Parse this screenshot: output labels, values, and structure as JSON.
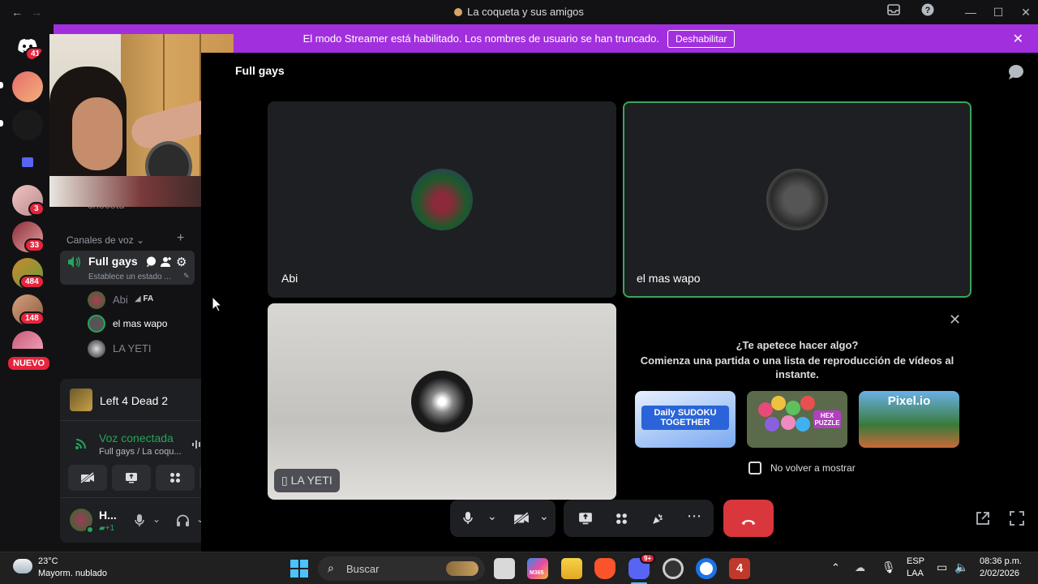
{
  "window": {
    "title": "La coqueta y sus amigos"
  },
  "banner": {
    "text": "El modo Streamer está habilitado. Los nombres de usuario se han truncado.",
    "button": "Deshabilitar"
  },
  "servers": {
    "home_badge": "41",
    "badges": [
      "3",
      "33",
      "484",
      "148"
    ],
    "new_label": "NUEVO"
  },
  "sidebar": {
    "hidden_channel": "chocotu",
    "section": "Canales de voz",
    "voice_channel": {
      "name": "Full gays",
      "status": "Establece un estado ..."
    },
    "members": [
      {
        "name": "Abi",
        "tag": "FA"
      },
      {
        "name": "el mas wapo"
      },
      {
        "name": "LA YETI"
      }
    ],
    "activity": {
      "game": "Left 4 Dead 2"
    },
    "voice": {
      "status": "Voz conectada",
      "detail": "Full gays / La coqu..."
    },
    "user": {
      "name": "H...",
      "sub": "+1"
    }
  },
  "main": {
    "channel": "Full gays",
    "tiles": [
      {
        "name": "Abi"
      },
      {
        "name": "el mas wapo"
      },
      {
        "name": "LA YETI"
      }
    ],
    "activity_card": {
      "title": "¿Te apetece hacer algo?",
      "subtitle": "Comienza una partida o una lista de reproducción de vídeos al instante.",
      "games": [
        "Daily SUDOKU TOGETHER",
        "HEX PUZZLE",
        "Pixel.io"
      ],
      "checkbox": "No volver a mostrar"
    }
  },
  "taskbar": {
    "weather_temp": "23°C",
    "weather_desc": "Mayorm. nublado",
    "search": "Buscar",
    "lang1": "ESP",
    "lang2": "LAA",
    "time": "08:36 p.m.",
    "date": "2/02/2026",
    "discord_badge": "9+",
    "m365": "M365"
  },
  "colors": {
    "accent": "#a22fde",
    "danger": "#da373c",
    "green": "#23a55a"
  }
}
